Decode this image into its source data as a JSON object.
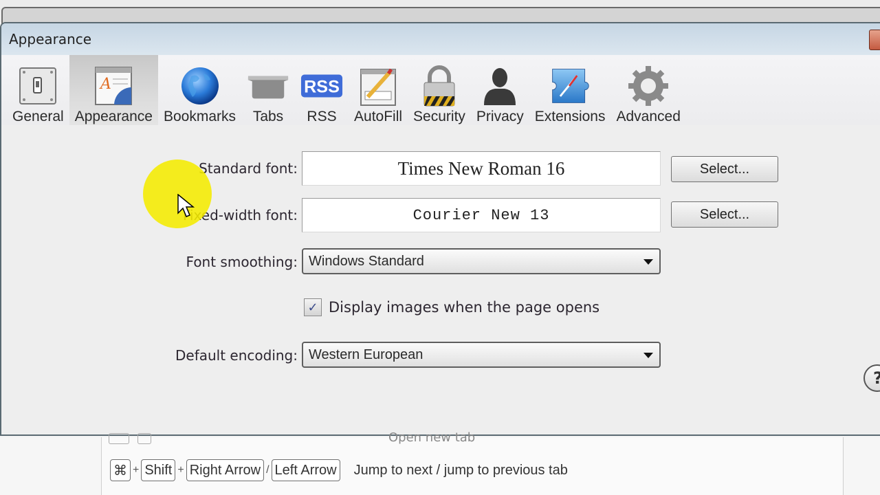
{
  "window": {
    "title": "Appearance"
  },
  "toolbar": {
    "items": [
      {
        "label": "General",
        "icon": "light-switch-icon",
        "active": false
      },
      {
        "label": "Appearance",
        "icon": "appearance-icon",
        "active": true
      },
      {
        "label": "Bookmarks",
        "icon": "globe-icon",
        "active": false
      },
      {
        "label": "Tabs",
        "icon": "tabs-icon",
        "active": false
      },
      {
        "label": "RSS",
        "icon": "rss-icon",
        "active": false
      },
      {
        "label": "AutoFill",
        "icon": "autofill-pencil-icon",
        "active": false
      },
      {
        "label": "Security",
        "icon": "padlock-icon",
        "active": false
      },
      {
        "label": "Privacy",
        "icon": "person-silhouette-icon",
        "active": false
      },
      {
        "label": "Extensions",
        "icon": "puzzle-compass-icon",
        "active": false
      },
      {
        "label": "Advanced",
        "icon": "gear-icon",
        "active": false
      }
    ],
    "rss_badge": "RSS"
  },
  "settings": {
    "standard_font": {
      "label": "Standard font:",
      "value": "Times New Roman 16",
      "button": "Select..."
    },
    "fixed_width_font": {
      "label": "Fixed-width font:",
      "value": "Courier New 13",
      "button": "Select..."
    },
    "font_smoothing": {
      "label": "Font smoothing:",
      "value": "Windows Standard"
    },
    "display_images": {
      "label": "Display images when the page opens",
      "checked": true,
      "check_glyph": "✓"
    },
    "default_encoding": {
      "label": "Default encoding:",
      "value": "Western European"
    }
  },
  "help": {
    "glyph": "?"
  },
  "background_doc": {
    "ghost_text": "Open new tab",
    "shortcut": {
      "keys": [
        "⌘",
        "Shift",
        "Right Arrow",
        "Left Arrow"
      ],
      "separators": [
        "+",
        "+",
        "/"
      ],
      "description": "Jump to next / jump to previous tab"
    }
  }
}
